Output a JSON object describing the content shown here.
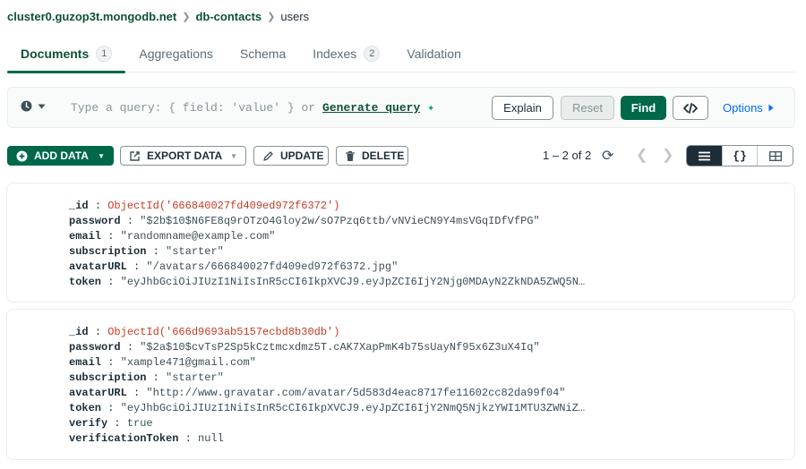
{
  "breadcrumb": {
    "cluster": "cluster0.guzop3t.mongodb.net",
    "database": "db-contacts",
    "collection": "users"
  },
  "tabs": [
    {
      "label": "Documents",
      "count": "1",
      "active": true
    },
    {
      "label": "Aggregations"
    },
    {
      "label": "Schema"
    },
    {
      "label": "Indexes",
      "count": "2"
    },
    {
      "label": "Validation"
    }
  ],
  "query": {
    "placeholder": "Type a query: { field: 'value' } or",
    "generate_label": "Generate query",
    "explain_label": "Explain",
    "reset_label": "Reset",
    "find_label": "Find",
    "options_label": "Options"
  },
  "toolbar": {
    "add_label": "ADD DATA",
    "export_label": "EXPORT DATA",
    "update_label": "UPDATE",
    "delete_label": "DELETE",
    "pager": "1 – 2 of 2"
  },
  "documents": [
    {
      "id_key": "_id",
      "id_value": "ObjectId('666840027fd409ed972f6372')",
      "fields": [
        {
          "key": "password",
          "value": "\"$2b$10$N6FE8q9rOTzO4Gloy2w/sO7Pzq6ttb/vNVieCN9Y4msVGqIDfVfPG\""
        },
        {
          "key": "email",
          "value": "\"randomname@example.com\""
        },
        {
          "key": "subscription",
          "value": "\"starter\""
        },
        {
          "key": "avatarURL",
          "value": "\"/avatars/666840027fd409ed972f6372.jpg\""
        },
        {
          "key": "token",
          "value": "\"eyJhbGciOiJIUzI1NiIsInR5cCI6IkpXVCJ9.eyJpZCI6IjY2Njg0MDAyN2ZkNDA5ZWQ5N…"
        }
      ]
    },
    {
      "id_key": "_id",
      "id_value": "ObjectId('666d9693ab5157ecbd8b30db')",
      "fields": [
        {
          "key": "password",
          "value": "\"$2a$10$cvTsP2Sp5kCztmcxdmz5T.cAK7XapPmK4b75sUayNf95x6Z3uX4Iq\""
        },
        {
          "key": "email",
          "value": "\"xample471@gmail.com\""
        },
        {
          "key": "subscription",
          "value": "\"starter\""
        },
        {
          "key": "avatarURL",
          "value": "\"http://www.gravatar.com/avatar/5d583d4eac8717fe11602cc82da99f04\""
        },
        {
          "key": "token",
          "value": "\"eyJhbGciOiJIUzI1NiIsInR5cCI6IkpXVCJ9.eyJpZCI6IjY2NmQ5NjkzYWI1MTU3ZWNiZ…"
        },
        {
          "key": "verify",
          "value": "true"
        },
        {
          "key": "verificationToken",
          "value": "null"
        }
      ]
    }
  ],
  "colors": {
    "brand_green": "#00684a",
    "dark_green": "#0e5134",
    "objectid_red": "#c73a26",
    "link_blue": "#016bf8"
  }
}
